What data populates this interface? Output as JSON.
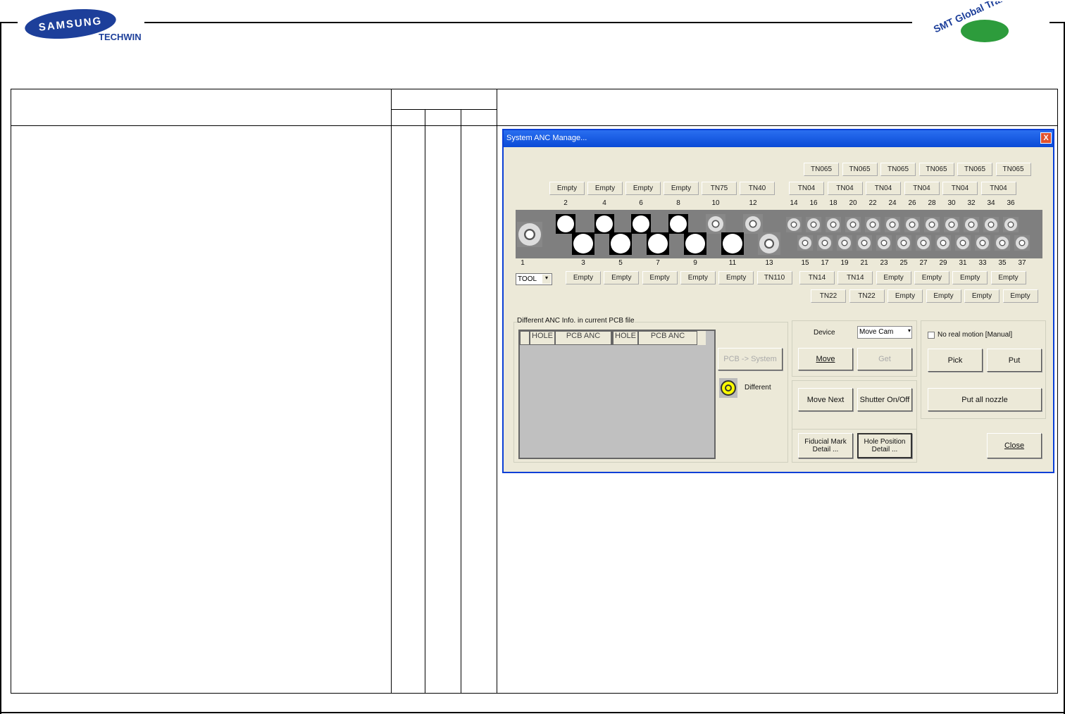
{
  "header": {
    "logo_left": "SAMSUNG",
    "logo_left_sub": "TECHWIN",
    "logo_right": "SMT Global Training Center"
  },
  "dialog": {
    "title": "System ANC Manage...",
    "close_glyph": "X",
    "top_row_labels": [
      "TN065",
      "TN065",
      "TN065",
      "TN065",
      "TN065",
      "TN065"
    ],
    "second_row_labels": [
      "Empty",
      "Empty",
      "Empty",
      "Empty",
      "TN75",
      "TN40",
      "TN04",
      "TN04",
      "TN04",
      "TN04",
      "TN04",
      "TN04"
    ],
    "even_numbers": [
      "2",
      "4",
      "6",
      "8",
      "10",
      "12",
      "14",
      "16",
      "18",
      "20",
      "22",
      "24",
      "26",
      "28",
      "30",
      "32",
      "34",
      "36"
    ],
    "odd_numbers": [
      "1",
      "3",
      "5",
      "7",
      "9",
      "11",
      "13",
      "15",
      "17",
      "19",
      "21",
      "23",
      "25",
      "27",
      "29",
      "31",
      "33",
      "35",
      "37"
    ],
    "tool_select": "TOOL",
    "third_row_labels": [
      "Empty",
      "Empty",
      "Empty",
      "Empty",
      "Empty",
      "TN110",
      "TN14",
      "TN14",
      "Empty",
      "Empty",
      "Empty",
      "Empty"
    ],
    "fourth_row_labels": [
      "TN22",
      "TN22",
      "Empty",
      "Empty",
      "Empty",
      "Empty"
    ],
    "diff_group": "Different ANC Info. in current PCB file",
    "columns": [
      "HOLE",
      "PCB ANC",
      "HOLE",
      "PCB ANC"
    ],
    "pcb_to_system": "PCB -> System",
    "different": "Different",
    "device_label": "Device",
    "device_select": "Move Cam",
    "move": "Move",
    "get": "Get",
    "move_next": "Move Next",
    "shutter": "Shutter On/Off",
    "no_real_motion": "No real motion [Manual]",
    "pick": "Pick",
    "put": "Put",
    "put_all": "Put all nozzle",
    "fiducial": "Fiducial Mark Detail ...",
    "hole_position": "Hole Position Detail ...",
    "close": "Close"
  }
}
